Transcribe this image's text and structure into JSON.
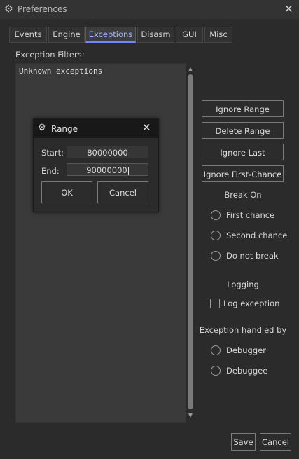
{
  "window": {
    "title": "Preferences",
    "icon": "gear-icon",
    "close_icon": "close-icon"
  },
  "tabs": [
    {
      "label": "Events"
    },
    {
      "label": "Engine"
    },
    {
      "label": "Exceptions",
      "active": true
    },
    {
      "label": "Disasm"
    },
    {
      "label": "GUI"
    },
    {
      "label": "Misc"
    }
  ],
  "filters": {
    "label": "Exception Filters:",
    "items": [
      "Unknown exceptions"
    ]
  },
  "side_buttons": {
    "ignore_range": "Ignore Range",
    "delete_range": "Delete Range",
    "ignore_last": "Ignore Last",
    "ignore_first_chance": "Ignore First-Chance"
  },
  "break_on": {
    "title": "Break On",
    "options": [
      "First chance",
      "Second chance",
      "Do not break"
    ]
  },
  "logging": {
    "title": "Logging",
    "checkbox_label": "Log exception",
    "checked": false
  },
  "handled_by": {
    "title": "Exception handled by",
    "options": [
      "Debugger",
      "Debuggee"
    ]
  },
  "footer": {
    "save": "Save",
    "cancel": "Cancel"
  },
  "range_dialog": {
    "title": "Range",
    "icon": "gear-icon",
    "start_label": "Start:",
    "start_value": "80000000",
    "end_label": "End:",
    "end_value": "90000000",
    "ok": "OK",
    "cancel": "Cancel"
  },
  "colors": {
    "accent": "#6f86ff",
    "background": "#2b2b2b"
  }
}
